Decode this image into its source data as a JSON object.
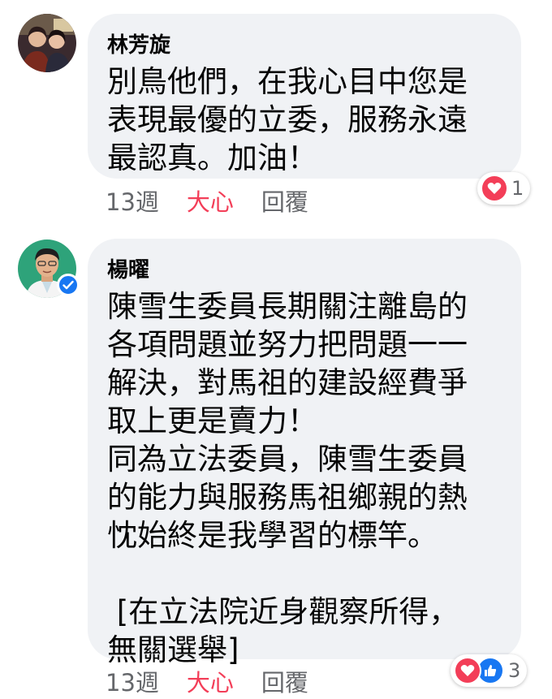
{
  "comments": [
    {
      "author": "林芳旋",
      "lines": [
        "別鳥他們，在我心目中您是",
        "表現最優的立委，服務永遠",
        "最認真。加油！"
      ],
      "time": "13週",
      "reaction_label": "大心",
      "reply_label": "回覆",
      "reaction_count": "1",
      "reaction_icons": [
        "heart-icon"
      ],
      "colors": {
        "heart": "#f33e58"
      }
    },
    {
      "author": "楊曜",
      "lines": [
        "陳雪生委員長期關注離島的",
        "各項問題並努力把問題一一",
        "解決，對馬祖的建設經費爭",
        "取上更是賣力！",
        "同為立法委員，陳雪生委員",
        "的能力與服務馬祖鄉親的熱",
        "忱始終是我學習的標竿。",
        "",
        " [在立法院近身觀察所得，",
        "無關選舉]"
      ],
      "time": "13週",
      "reaction_label": "大心",
      "reply_label": "回覆",
      "reaction_count": "3",
      "reaction_icons": [
        "heart-icon",
        "thumbs-up-icon"
      ],
      "verified": true,
      "colors": {
        "heart": "#f33e58",
        "like": "#1877f2"
      }
    }
  ]
}
